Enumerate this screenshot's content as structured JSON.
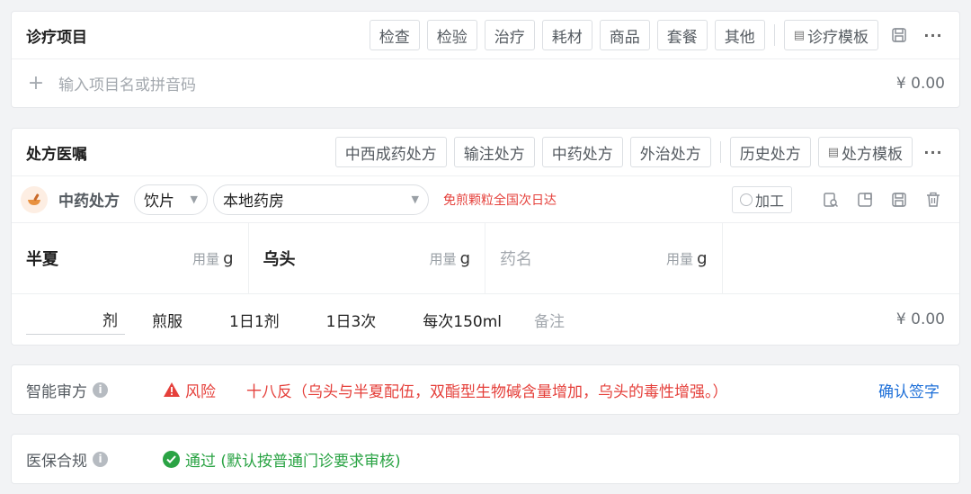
{
  "treatment": {
    "title": "诊疗项目",
    "categories": [
      "检查",
      "检验",
      "治疗",
      "耗材",
      "商品",
      "套餐",
      "其他"
    ],
    "template_label": "诊疗模板",
    "input_placeholder": "输入项目名或拼音码",
    "total": "¥ 0.00"
  },
  "prescription": {
    "title": "处方医嘱",
    "types": [
      "中西成药处方",
      "输注处方",
      "中药处方",
      "外治处方"
    ],
    "history_label": "历史处方",
    "template_label": "处方模板",
    "rx_type_label": "中药处方",
    "form_select": "饮片",
    "pharmacy_select": "本地药房",
    "warning": "免煎颗粒全国次日达",
    "processing_label": "加工",
    "herbs": [
      {
        "name": "半夏",
        "dose_label": "用量",
        "unit": "g"
      },
      {
        "name": "乌头",
        "dose_label": "用量",
        "unit": "g"
      },
      {
        "name": "药名",
        "dose_label": "用量",
        "unit": "g"
      },
      {
        "name": "",
        "dose_label": "",
        "unit": ""
      }
    ],
    "usage": {
      "dose_unit": "剂",
      "method": "煎服",
      "daily_doses": "1日1剂",
      "frequency": "1日3次",
      "amount": "每次150ml",
      "note": "备注",
      "total": "¥ 0.00"
    }
  },
  "review": {
    "label": "智能审方",
    "risk_label": "风险",
    "risk_detail": "十八反（乌头与半夏配伍，双酯型生物碱含量增加，乌头的毒性增强。）",
    "confirm_label": "确认签字"
  },
  "insurance": {
    "label": "医保合规",
    "result": "通过 (默认按普通门诊要求审核)"
  },
  "colors": {
    "risk": "#e5403b",
    "pass": "#2aa344",
    "link": "#1d6fd8"
  }
}
